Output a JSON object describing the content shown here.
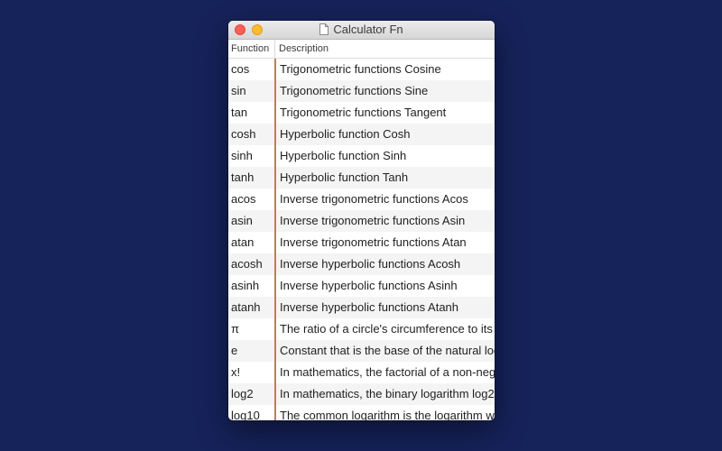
{
  "window": {
    "title": "Calculator Fn"
  },
  "table": {
    "headers": {
      "function": "Function",
      "description": "Description"
    },
    "rows": [
      {
        "function": "cos",
        "description": "Trigonometric functions Cosine"
      },
      {
        "function": "sin",
        "description": "Trigonometric functions Sine"
      },
      {
        "function": "tan",
        "description": "Trigonometric functions Tangent"
      },
      {
        "function": "cosh",
        "description": "Hyperbolic function Cosh"
      },
      {
        "function": "sinh",
        "description": "Hyperbolic function Sinh"
      },
      {
        "function": "tanh",
        "description": "Hyperbolic function Tanh"
      },
      {
        "function": "acos",
        "description": "Inverse trigonometric functions Acos"
      },
      {
        "function": "asin",
        "description": "Inverse trigonometric functions Asin"
      },
      {
        "function": "atan",
        "description": "Inverse trigonometric functions Atan"
      },
      {
        "function": "acosh",
        "description": "Inverse hyperbolic functions Acosh"
      },
      {
        "function": "asinh",
        "description": "Inverse hyperbolic functions Asinh"
      },
      {
        "function": "atanh",
        "description": "Inverse hyperbolic functions Atanh"
      },
      {
        "function": "π",
        "description": "The ratio of a circle's circumference to its d"
      },
      {
        "function": "e",
        "description": "Constant that is the base of the natural log"
      },
      {
        "function": "x!",
        "description": "In mathematics, the factorial of a non-nega"
      },
      {
        "function": "log2",
        "description": "In mathematics, the binary logarithm log2"
      },
      {
        "function": "log10",
        "description": "The common logarithm is the logarithm wit"
      }
    ]
  }
}
